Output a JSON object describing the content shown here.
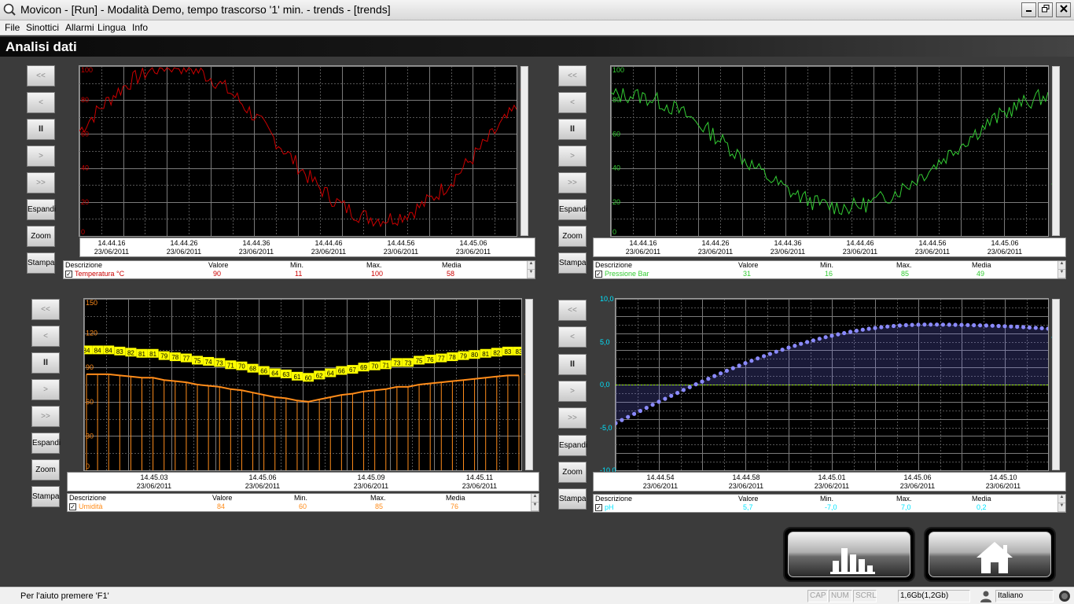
{
  "window": {
    "title": "Movicon - [Run] - Modalità Demo, tempo trascorso '1' min. - trends - [trends]"
  },
  "menu": [
    "File",
    "Sinottici",
    "Allarmi",
    "Lingua",
    "Info"
  ],
  "page": {
    "title": "Analisi dati"
  },
  "nav_buttons": {
    "first": "<<",
    "prev": "<",
    "pause": "II",
    "next": ">",
    "last": ">>",
    "expand": "Espandi",
    "zoom": "Zoom",
    "print": "Stampa"
  },
  "legend_headers": {
    "desc": "Descrizione",
    "value": "Valore",
    "min": "Min.",
    "max": "Max.",
    "avg": "Media"
  },
  "panels": [
    {
      "id": "temperature",
      "color": "#cc0000",
      "y_ticks": [
        "100",
        "80",
        "60",
        "40",
        "20",
        "0"
      ],
      "x_ticks": [
        {
          "time": "14.44.16",
          "date": "23/06/2011"
        },
        {
          "time": "14.44.26",
          "date": "23/06/2011"
        },
        {
          "time": "14.44.36",
          "date": "23/06/2011"
        },
        {
          "time": "14.44.46",
          "date": "23/06/2011"
        },
        {
          "time": "14.44.56",
          "date": "23/06/2011"
        },
        {
          "time": "14.45.06",
          "date": "23/06/2011"
        }
      ],
      "legend": {
        "desc": "Temperatura °C",
        "value": "90",
        "min": "11",
        "max": "100",
        "avg": "58"
      }
    },
    {
      "id": "pressure",
      "color": "#33cc33",
      "y_ticks": [
        "100",
        "80",
        "60",
        "40",
        "20",
        "0"
      ],
      "x_ticks": [
        {
          "time": "14.44.16",
          "date": "23/06/2011"
        },
        {
          "time": "14.44.26",
          "date": "23/06/2011"
        },
        {
          "time": "14.44.36",
          "date": "23/06/2011"
        },
        {
          "time": "14.44.46",
          "date": "23/06/2011"
        },
        {
          "time": "14.44.56",
          "date": "23/06/2011"
        },
        {
          "time": "14.45.06",
          "date": "23/06/2011"
        }
      ],
      "legend": {
        "desc": "Pressione Bar",
        "value": "31",
        "min": "16",
        "max": "85",
        "avg": "49"
      }
    },
    {
      "id": "humidity",
      "color": "#ff8c1a",
      "y_ticks": [
        "150",
        "120",
        "90",
        "60",
        "30",
        "0"
      ],
      "x_ticks": [
        {
          "time": "14.45.03",
          "date": "23/06/2011"
        },
        {
          "time": "14.45.06",
          "date": "23/06/2011"
        },
        {
          "time": "14.45.09",
          "date": "23/06/2011"
        },
        {
          "time": "14.45.11",
          "date": "23/06/2011"
        }
      ],
      "value_labels": [
        "84",
        "84",
        "84",
        "83",
        "82",
        "81",
        "81",
        "79",
        "78",
        "77",
        "75",
        "74",
        "73",
        "71",
        "70",
        "68",
        "66",
        "64",
        "63",
        "61",
        "60",
        "62",
        "64",
        "66",
        "67",
        "69",
        "70",
        "71",
        "73",
        "73",
        "75",
        "76",
        "77",
        "78",
        "79",
        "80",
        "81",
        "82",
        "83",
        "83"
      ],
      "legend": {
        "desc": "Umidità",
        "value": "84",
        "min": "60",
        "max": "85",
        "avg": "76"
      }
    },
    {
      "id": "ph",
      "color": "#00e5ff",
      "y_ticks": [
        "10,0",
        "5,0",
        "0,0",
        "-5,0",
        "-10,0"
      ],
      "x_ticks": [
        {
          "time": "14.44.54",
          "date": "23/06/2011"
        },
        {
          "time": "14.44.58",
          "date": "23/06/2011"
        },
        {
          "time": "14.45.01",
          "date": "23/06/2011"
        },
        {
          "time": "14.45.06",
          "date": "23/06/2011"
        },
        {
          "time": "14.45.10",
          "date": "23/06/2011"
        }
      ],
      "legend": {
        "desc": "pH",
        "value": "5,7",
        "min": "-7,0",
        "max": "7,0",
        "avg": "0,2"
      }
    }
  ],
  "status": {
    "help": "Per l'aiuto premere 'F1'",
    "cap": "CAP",
    "num": "NUM",
    "scrl": "SCRL",
    "memory": "1,6Gb(1,2Gb)",
    "language": "Italiano"
  }
}
